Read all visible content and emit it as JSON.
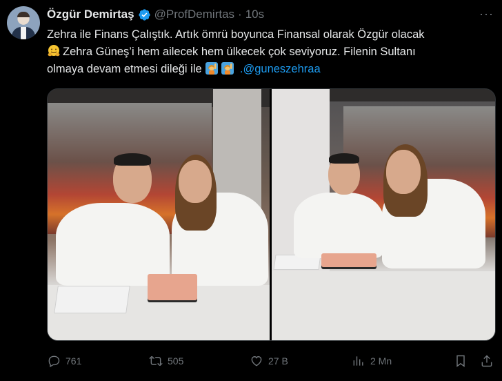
{
  "author": {
    "name": "Özgür Demirtaş",
    "handle": "@ProfDemirtas",
    "separator": "·",
    "time": "10s",
    "avatar_icon": "avatar-photo",
    "verified_icon": "verified-badge-icon"
  },
  "tweet": {
    "line1": "Zehra ile Finans Çalıştık. Artık ömrü boyunca Finansal olarak Özgür olacak",
    "line2": "Zehra Güneş’i hem ailecek hem ülkecek çok seviyoruz. Filenin Sultanı",
    "line3": "olmaya devam etmesi dileği ile",
    "mention_prefix": ".",
    "mention": "@guneszehraa",
    "emojis": [
      "hugging-face-emoji",
      "woman-raising-hand-emoji",
      "woman-raising-hand-emoji"
    ]
  },
  "media": {
    "photos": [
      "photo-1",
      "photo-2"
    ]
  },
  "actions": {
    "reply_count": "761",
    "retweet_count": "505",
    "like_count": "27 B",
    "view_count": "2 Mn",
    "more_label": "···"
  },
  "colors": {
    "background": "#000000",
    "text": "#e7e9ea",
    "secondary": "#71767b",
    "accent": "#1d9bf0"
  }
}
